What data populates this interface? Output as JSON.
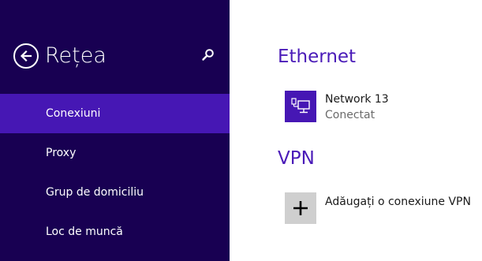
{
  "nav": {
    "title": "Rețea",
    "back_icon": "back-arrow-icon",
    "search_icon": "search-icon",
    "items": [
      {
        "label": "Conexiuni",
        "selected": true
      },
      {
        "label": "Proxy",
        "selected": false
      },
      {
        "label": "Grup de domiciliu",
        "selected": false
      },
      {
        "label": "Loc de muncă",
        "selected": false
      }
    ]
  },
  "content": {
    "ethernet": {
      "title": "Ethernet",
      "connection": {
        "name": "Network  13",
        "status": "Conectat",
        "icon": "ethernet-network-icon"
      }
    },
    "vpn": {
      "title": "VPN",
      "add": {
        "label": "Adăugați o conexiune VPN",
        "icon": "plus-icon"
      }
    }
  },
  "colors": {
    "nav_background": "#180052",
    "nav_selected": "#4617b4",
    "accent": "#4a1bb8",
    "add_tile": "#cfcfcf"
  }
}
